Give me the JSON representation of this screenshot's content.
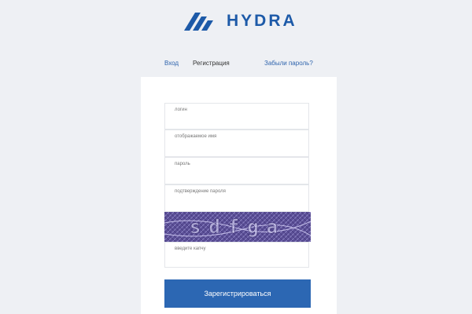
{
  "brand": {
    "name": "HYDRA",
    "color": "#1d5aa8"
  },
  "nav": {
    "login": "Вход",
    "register": "Регистрация",
    "forgot": "Забыли пароль?"
  },
  "form": {
    "fields": [
      {
        "label": "логин",
        "value": ""
      },
      {
        "label": "отображаемое имя",
        "value": ""
      },
      {
        "label": "пароль",
        "value": ""
      },
      {
        "label": "подтверждение пароля",
        "value": ""
      },
      {
        "label": "введите капчу",
        "value": ""
      }
    ],
    "captcha": {
      "text": "sdfga",
      "color": "#5b4f96"
    },
    "submit_label": "Зарегистрироваться",
    "accent_color": "#2c67b3"
  }
}
